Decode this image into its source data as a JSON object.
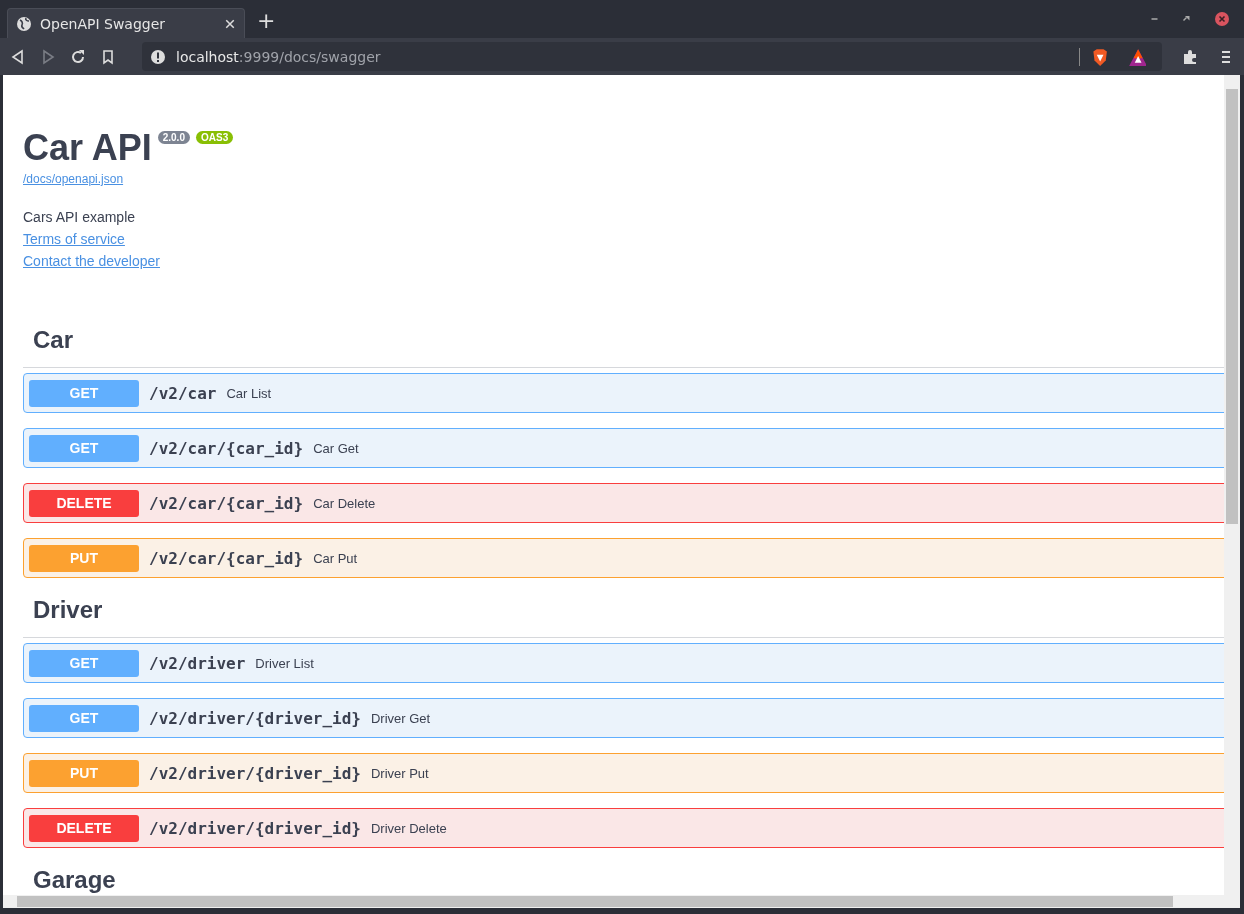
{
  "browser": {
    "tab_title": "OpenAPI Swagger",
    "new_tab": "+",
    "address": {
      "host": "localhost",
      "rest": ":9999/docs/swagger"
    },
    "forward_disabled": true
  },
  "info": {
    "title": "Car API",
    "version": "2.0.0",
    "spec": "OAS3",
    "spec_link": "/docs/openapi.json",
    "description": "Cars API example",
    "links": [
      "Terms of service",
      "Contact the developer"
    ]
  },
  "sections": [
    {
      "name": "Car",
      "operations": [
        {
          "method": "GET",
          "path": "/v2/car",
          "summary": "Car List"
        },
        {
          "method": "GET",
          "path": "/v2/car/{car_id}",
          "summary": "Car Get"
        },
        {
          "method": "DELETE",
          "path": "/v2/car/{car_id}",
          "summary": "Car Delete"
        },
        {
          "method": "PUT",
          "path": "/v2/car/{car_id}",
          "summary": "Car Put"
        }
      ]
    },
    {
      "name": "Driver",
      "operations": [
        {
          "method": "GET",
          "path": "/v2/driver",
          "summary": "Driver List"
        },
        {
          "method": "GET",
          "path": "/v2/driver/{driver_id}",
          "summary": "Driver Get"
        },
        {
          "method": "PUT",
          "path": "/v2/driver/{driver_id}",
          "summary": "Driver Put"
        },
        {
          "method": "DELETE",
          "path": "/v2/driver/{driver_id}",
          "summary": "Driver Delete"
        }
      ]
    },
    {
      "name": "Garage"
    }
  ]
}
